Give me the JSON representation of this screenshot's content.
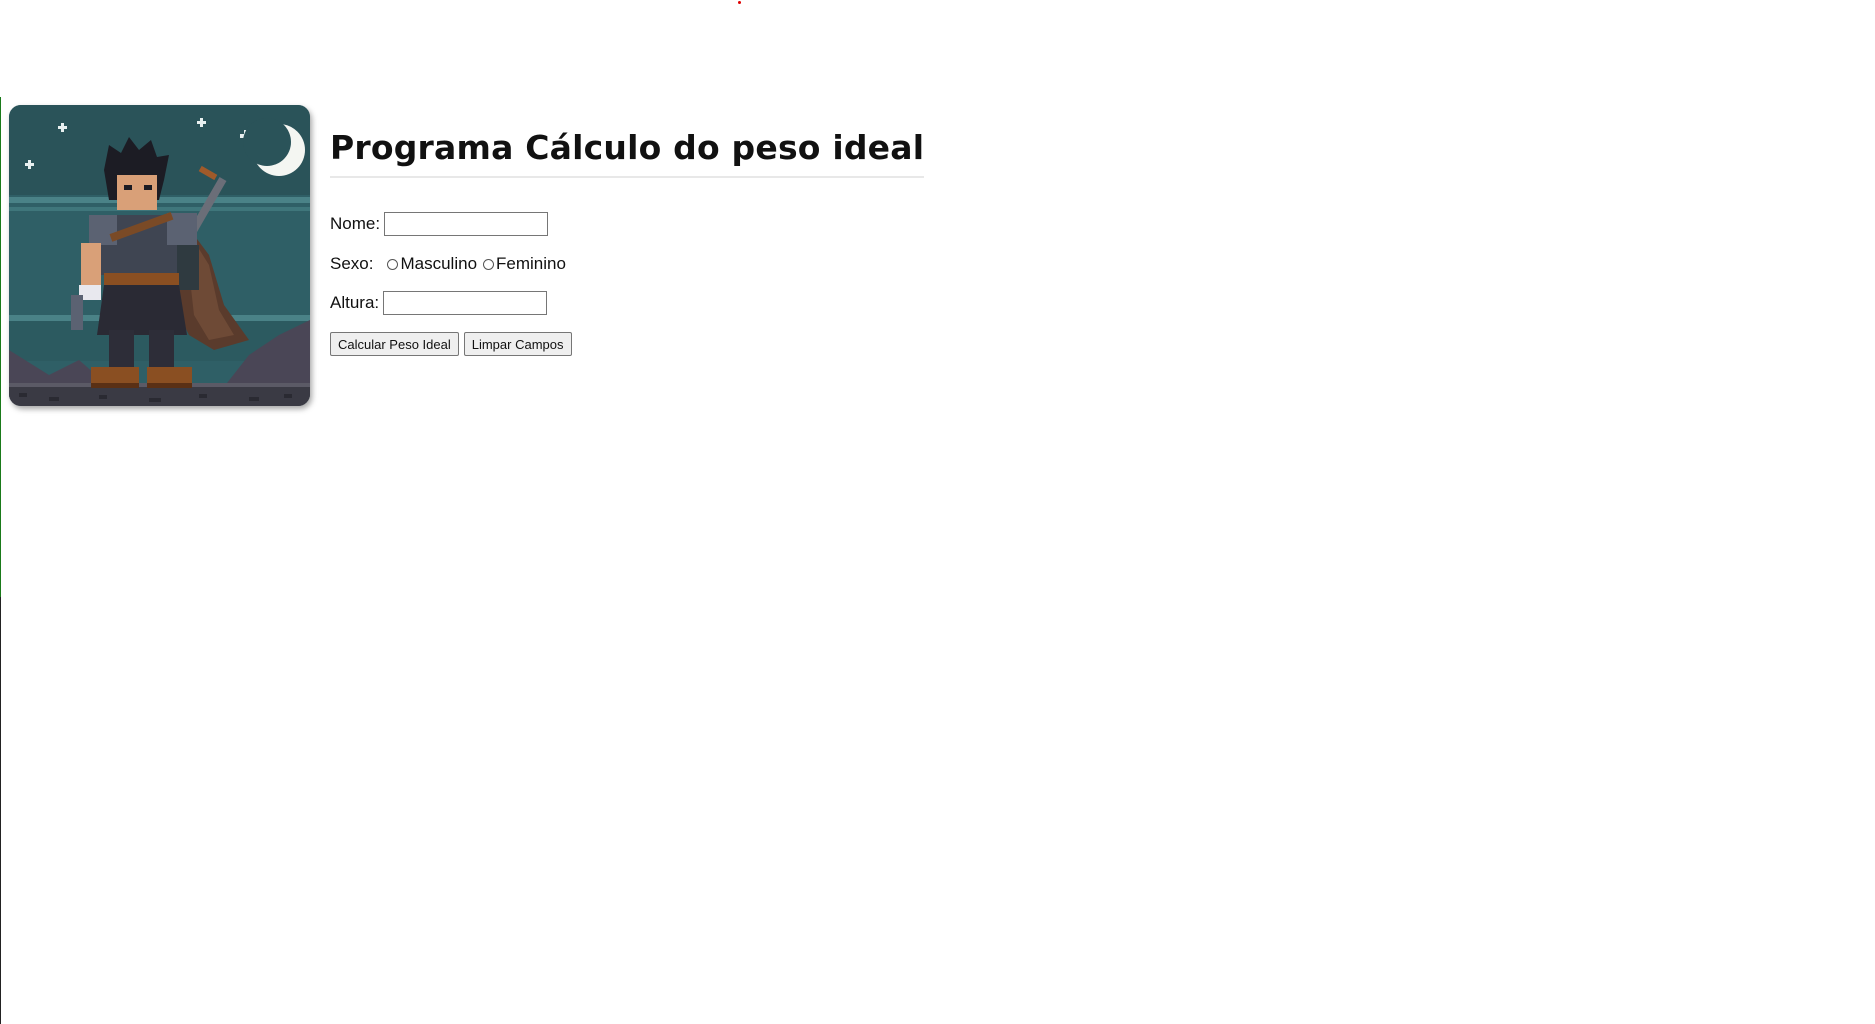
{
  "page": {
    "title": "Programa Cálculo do peso ideal"
  },
  "form": {
    "nome_label": "Nome:",
    "nome_value": "",
    "sexo_label": "Sexo:",
    "sexo_options": [
      "Masculino",
      "Feminino"
    ],
    "altura_label": "Altura:",
    "altura_value": "",
    "calcular_button": "Calcular Peso Ideal",
    "limpar_button": "Limpar Campos"
  },
  "colors": {
    "avatar_sky": "#2f5f66",
    "avatar_ground": "#3a3a44",
    "accent_dot": "#e00000"
  },
  "icons": {
    "avatar": "pixel-art-warrior-character"
  }
}
